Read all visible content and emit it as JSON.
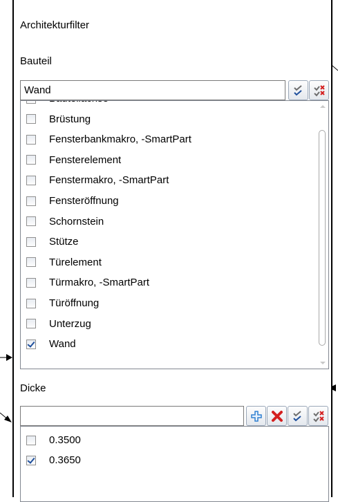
{
  "panel": {
    "title": "Architekturfilter"
  },
  "bauteil": {
    "label": "Bauteil",
    "combo_value": "Wand",
    "items": [
      {
        "label": "Bauteilachse",
        "checked": false
      },
      {
        "label": "Brüstung",
        "checked": false
      },
      {
        "label": "Fensterbankmakro, -SmartPart",
        "checked": false
      },
      {
        "label": "Fensterelement",
        "checked": false
      },
      {
        "label": "Fenstermakro, -SmartPart",
        "checked": false
      },
      {
        "label": "Fensteröffnung",
        "checked": false
      },
      {
        "label": "Schornstein",
        "checked": false
      },
      {
        "label": "Stütze",
        "checked": false
      },
      {
        "label": "Türelement",
        "checked": false
      },
      {
        "label": "Türmakro, -SmartPart",
        "checked": false
      },
      {
        "label": "Türöffnung",
        "checked": false
      },
      {
        "label": "Unterzug",
        "checked": false
      },
      {
        "label": "Wand",
        "checked": true
      }
    ]
  },
  "dicke": {
    "label": "Dicke",
    "combo_value": "",
    "items": [
      {
        "label": "0.3500",
        "checked": false
      },
      {
        "label": "0.3650",
        "checked": true
      }
    ]
  },
  "icons": {
    "check_all": "check-all-icon",
    "uncheck_all": "uncheck-all-icon",
    "add": "plus-icon",
    "delete": "red-x-icon"
  },
  "colors": {
    "check": "#1e4f9c",
    "delete": "#d42020",
    "add": "#2f7fd0"
  }
}
